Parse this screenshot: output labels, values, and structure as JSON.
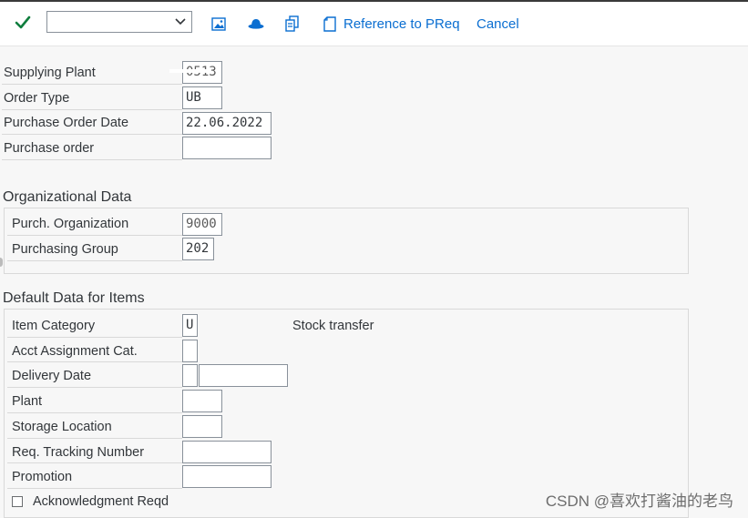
{
  "toolbar": {
    "check_icon": "check-icon",
    "dropdown_value": "",
    "reference_label": "Reference to PReq",
    "cancel_label": "Cancel"
  },
  "header_fields": [
    {
      "label": "Supplying Plant",
      "value": "0513"
    },
    {
      "label": "Order Type",
      "value": "UB"
    },
    {
      "label": "Purchase Order Date",
      "value": "22.06.2022"
    },
    {
      "label": "Purchase order",
      "value": ""
    }
  ],
  "org_data": {
    "title": "Organizational Data",
    "fields": [
      {
        "label": "Purch. Organization",
        "value": "9000"
      },
      {
        "label": "Purchasing Group",
        "value": "202"
      }
    ]
  },
  "default_items": {
    "title": "Default Data for Items",
    "fields": [
      {
        "label": "Item Category",
        "value": "U",
        "description": "Stock transfer"
      },
      {
        "label": "Acct Assignment Cat.",
        "value": ""
      },
      {
        "label": "Delivery Date",
        "value": "",
        "value2": ""
      },
      {
        "label": "Plant",
        "value": ""
      },
      {
        "label": "Storage Location",
        "value": ""
      },
      {
        "label": "Req. Tracking Number",
        "value": ""
      },
      {
        "label": "Promotion",
        "value": ""
      }
    ],
    "acknowledgment_label": "Acknowledgment Reqd",
    "acknowledgment_checked": false
  },
  "watermark": "CSDN @喜欢打酱油的老鸟",
  "colors": {
    "accent": "#0a6ed1",
    "check": "#107e3e"
  }
}
